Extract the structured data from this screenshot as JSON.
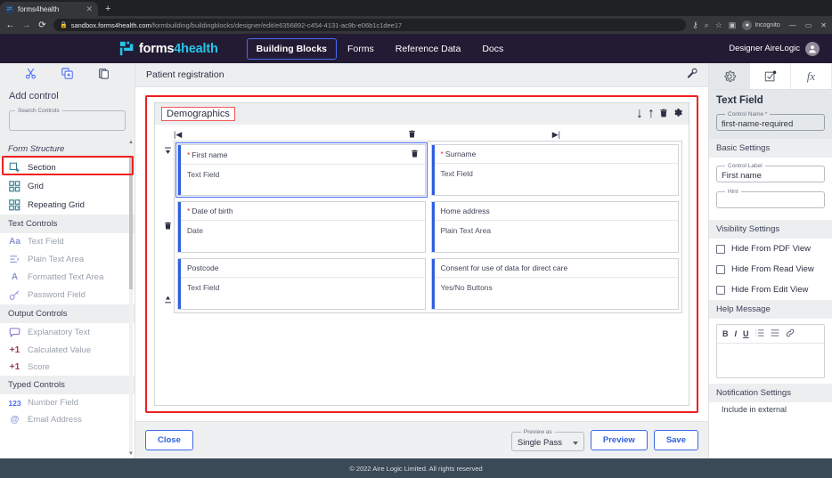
{
  "browser": {
    "tab_title": "forms4health",
    "tab_close_glyph": "✕",
    "new_tab_glyph": "+",
    "back_glyph": "←",
    "forward_glyph": "→",
    "reload_glyph": "⟳",
    "lock_glyph": "🔒",
    "url_host": "sandbox.forms4health.com",
    "url_path": "/formbuilding/buildingblocks/designer/edit/e6356892-c454-4131-ac9b-e06b1c1dee17",
    "key_icon": "⚷",
    "zoom_icon": "⌕",
    "star_icon": "☆",
    "sidepanel_icon": "▣",
    "incognito_label": "Incognito",
    "win_minimize": "—",
    "win_maximize": "▭",
    "win_close": "✕"
  },
  "header": {
    "brand_first": "forms",
    "brand_second": "4health",
    "nav": [
      {
        "label": "Building Blocks",
        "active": true
      },
      {
        "label": "Forms",
        "active": false
      },
      {
        "label": "Reference Data",
        "active": false
      },
      {
        "label": "Docs",
        "active": false
      }
    ],
    "user_name": "Designer AireLogic",
    "accent_active": "#4a6cf7",
    "background": "#221b33",
    "brand_cyan": "#28c3e8"
  },
  "sidebar": {
    "tools": [
      {
        "name": "cut-icon",
        "glyph": "✂"
      },
      {
        "name": "duplicate-icon",
        "glyph": "⧉"
      },
      {
        "name": "paste-icon",
        "glyph": "📋"
      }
    ],
    "title": "Add control",
    "search_legend": "Search Controls",
    "search_value": "",
    "search_placeholder": "",
    "groups": [
      {
        "label": "Form Structure",
        "italic": true,
        "items": [
          {
            "label": "Section",
            "icon": "section-icon",
            "enabled": true,
            "highlighted": true
          },
          {
            "label": "Grid",
            "icon": "grid-icon",
            "enabled": true,
            "highlighted": false
          },
          {
            "label": "Repeating Grid",
            "icon": "repeating-grid-icon",
            "enabled": true,
            "highlighted": false
          }
        ]
      },
      {
        "label": "Text Controls",
        "italic": false,
        "items": [
          {
            "label": "Text Field",
            "icon": "text-field-icon",
            "enabled": false,
            "icon_text": "Aa"
          },
          {
            "label": "Plain Text Area",
            "icon": "plain-text-area-icon",
            "enabled": false
          },
          {
            "label": "Formatted Text Area",
            "icon": "formatted-text-area-icon",
            "enabled": false,
            "icon_text": "A"
          },
          {
            "label": "Password Field",
            "icon": "password-field-icon",
            "enabled": false
          }
        ]
      },
      {
        "label": "Output Controls",
        "italic": false,
        "items": [
          {
            "label": "Explanatory Text",
            "icon": "explanatory-text-icon",
            "enabled": false
          },
          {
            "label": "Calculated Value",
            "icon": "calculated-value-icon",
            "enabled": false,
            "icon_text": "+1"
          },
          {
            "label": "Score",
            "icon": "score-icon",
            "enabled": false,
            "icon_text": "+1"
          }
        ]
      },
      {
        "label": "Typed Controls",
        "italic": false,
        "items": [
          {
            "label": "Number Field",
            "icon": "number-field-icon",
            "enabled": false,
            "icon_text": "123"
          },
          {
            "label": "Email Address",
            "icon": "email-address-icon",
            "enabled": false,
            "icon_text": "@"
          }
        ]
      }
    ],
    "highlight_color": "#ee2020"
  },
  "center": {
    "page_title": "Patient registration",
    "wrench_icon": "wrench-icon",
    "section": {
      "name": "Demographics",
      "tools": [
        {
          "name": "move-down-icon",
          "glyph": "↓"
        },
        {
          "name": "move-up-icon",
          "glyph": "↑"
        },
        {
          "name": "delete-section-icon",
          "glyph": "🗑"
        },
        {
          "name": "section-settings-icon",
          "glyph": "⚙"
        }
      ]
    },
    "column_tools": [
      {
        "name": "move-column-left-icon",
        "glyph": "|◀"
      },
      {
        "name": "delete-column-icon",
        "glyph": "🗑"
      },
      {
        "name": "move-column-right-icon",
        "glyph": "▶|"
      }
    ],
    "row_tools": [
      {
        "name": "move-row-top-icon",
        "glyph": "⤒"
      },
      {
        "name": "delete-row-icon",
        "glyph": "🗑"
      },
      {
        "name": "move-row-bottom-icon",
        "glyph": "⤓"
      }
    ],
    "grid_rows": [
      [
        {
          "label": "First name",
          "required": true,
          "type": "Text Field",
          "selected": true,
          "has_trash": true
        },
        {
          "label": "Surname",
          "required": true,
          "type": "Text Field",
          "selected": false,
          "has_trash": false
        }
      ],
      [
        {
          "label": "Date of birth",
          "required": true,
          "type": "Date",
          "selected": false,
          "has_trash": false
        },
        {
          "label": "Home address",
          "required": false,
          "type": "Plain Text Area",
          "selected": false,
          "has_trash": false
        }
      ],
      [
        {
          "label": "Postcode",
          "required": false,
          "type": "Text Field",
          "selected": false,
          "has_trash": false
        },
        {
          "label": "Consent for use of data for direct care",
          "required": false,
          "type": "Yes/No Buttons",
          "selected": false,
          "has_trash": false
        }
      ]
    ],
    "highlight_color": "#ee2020"
  },
  "bottom_bar": {
    "close_label": "Close",
    "preview_as_legend": "Preview as",
    "preview_as_value": "Single Pass",
    "preview_label": "Preview",
    "save_label": "Save"
  },
  "right_panel": {
    "tabs": [
      {
        "name": "settings-tab",
        "icon": "gear-icon",
        "glyph": "⚙",
        "active": true
      },
      {
        "name": "validation-tab",
        "icon": "checkbox-icon",
        "glyph": "☑",
        "active": false
      },
      {
        "name": "expression-tab",
        "icon": "fx-icon",
        "glyph": "fx",
        "active": false
      }
    ],
    "title": "Text Field",
    "control_name_legend": "Control Name *",
    "control_name_value": "first-name-required",
    "basic_settings_label": "Basic Settings",
    "control_label_legend": "Control Label",
    "control_label_value": "First name",
    "hint_legend": "Hint",
    "hint_value": "",
    "visibility_settings_label": "Visibility Settings",
    "visibility_options": [
      {
        "label": "Hide From PDF View",
        "checked": false
      },
      {
        "label": "Hide From Read View",
        "checked": false
      },
      {
        "label": "Hide From Edit View",
        "checked": false
      }
    ],
    "help_message_label": "Help Message",
    "editor_tools": [
      {
        "name": "bold-icon",
        "glyph": "B"
      },
      {
        "name": "italic-icon",
        "glyph": "I"
      },
      {
        "name": "underline-icon",
        "glyph": "U"
      },
      {
        "name": "ordered-list-icon",
        "glyph": "☰"
      },
      {
        "name": "unordered-list-icon",
        "glyph": "☰"
      },
      {
        "name": "link-icon",
        "glyph": "🔗"
      }
    ],
    "help_message_value": "",
    "notification_settings_label": "Notification Settings",
    "notification_partial": "Include in external"
  },
  "footer": {
    "copyright": "© 2022 Aire Logic Limited. All rights reserved"
  }
}
